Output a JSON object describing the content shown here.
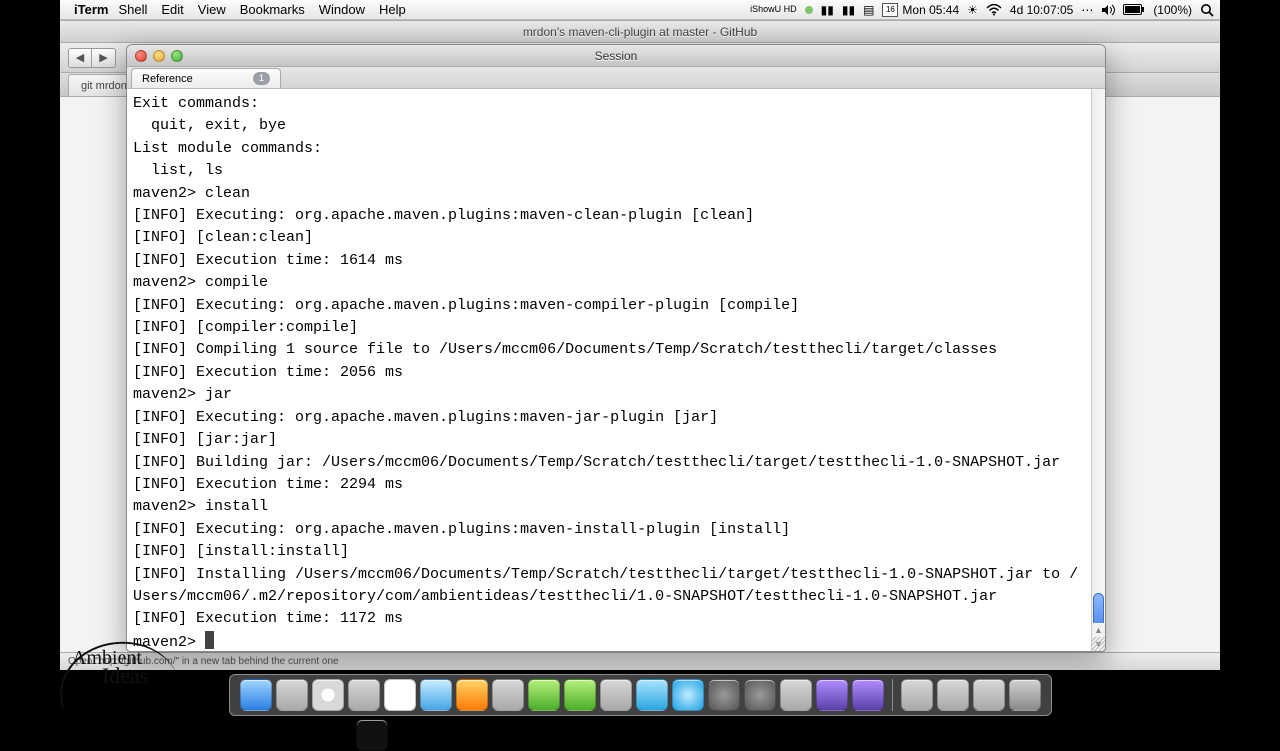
{
  "menubar": {
    "app_name": "iTerm",
    "menus": [
      "Shell",
      "Edit",
      "View",
      "Bookmarks",
      "Window",
      "Help"
    ],
    "recorder": "iShowU HD",
    "cal_day": "16",
    "clock": "Mon 05:44",
    "uptime": "4d 10:07:05",
    "battery": "(100%)"
  },
  "safari": {
    "title": "mrdon's maven-cli-plugin at master - GitHub",
    "tab": "git  mrdon",
    "status": "Open \"http://github.com/\" in a new tab behind the current one"
  },
  "terminal": {
    "window_title": "Session",
    "tab_name": "Reference",
    "tab_badge": "1",
    "prompt": "maven2>",
    "lines": [
      "Exit commands:",
      "  quit, exit, bye",
      "List module commands:",
      "  list, ls",
      "maven2> clean",
      "[INFO] Executing: org.apache.maven.plugins:maven-clean-plugin [clean]",
      "[INFO] [clean:clean]",
      "[INFO] Execution time: 1614 ms",
      "maven2> compile",
      "[INFO] Executing: org.apache.maven.plugins:maven-compiler-plugin [compile]",
      "[INFO] [compiler:compile]",
      "[INFO] Compiling 1 source file to /Users/mccm06/Documents/Temp/Scratch/testthecli/target/classes",
      "[INFO] Execution time: 2056 ms",
      "maven2> jar",
      "[INFO] Executing: org.apache.maven.plugins:maven-jar-plugin [jar]",
      "[INFO] [jar:jar]",
      "[INFO] Building jar: /Users/mccm06/Documents/Temp/Scratch/testthecli/target/testthecli-1.0-SNAPSHOT.jar",
      "[INFO] Execution time: 2294 ms",
      "maven2> install",
      "[INFO] Executing: org.apache.maven.plugins:maven-install-plugin [install]",
      "[INFO] [install:install]",
      "[INFO] Installing /Users/mccm06/Documents/Temp/Scratch/testthecli/target/testthecli-1.0-SNAPSHOT.jar to /Users/mccm06/.m2/repository/com/ambientideas/testthecli/1.0-SNAPSHOT/testthecli-1.0-SNAPSHOT.jar",
      "[INFO] Execution time: 1172 ms"
    ]
  },
  "logo": {
    "line1": "Ambient",
    "line2": "Ideas"
  },
  "dock_icons": [
    "finder",
    "preview",
    "safari",
    "contacts",
    "cal",
    "itunes",
    "photo",
    "todo",
    "green",
    "green",
    "aqua",
    "tw",
    "skype",
    "term",
    "gear",
    "gear",
    "aqua",
    "purple",
    "purple"
  ],
  "dock_icons_right": [
    "doc",
    "folder",
    "app",
    "trash"
  ]
}
